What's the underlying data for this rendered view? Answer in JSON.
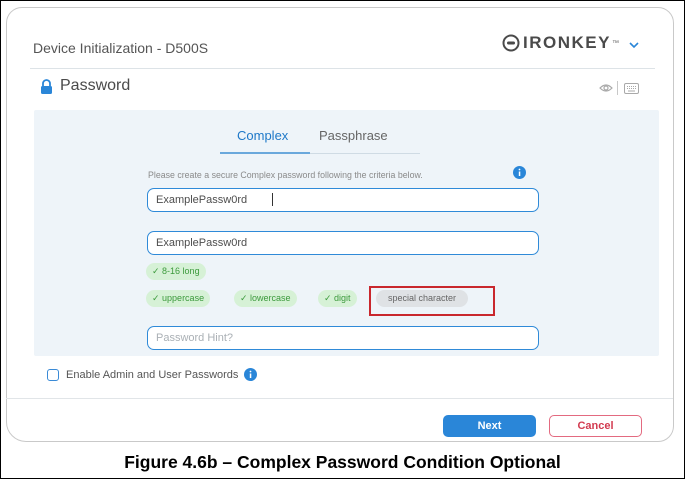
{
  "window": {
    "title": "Device Initialization - D500S",
    "brand": "IRONKEY",
    "brand_tm": "™"
  },
  "section": {
    "label": "Password"
  },
  "tabs": [
    {
      "label": "Complex",
      "active": true
    },
    {
      "label": "Passphrase",
      "active": false
    }
  ],
  "instructions": "Please create a secure Complex password following the criteria below.",
  "fields": {
    "password_value": "ExamplePassw0rd",
    "confirm_value": "ExamplePassw0rd",
    "hint_placeholder": "Password Hint?"
  },
  "criteria": [
    {
      "label": "✓ 8-16 long",
      "met": true
    },
    {
      "label": "✓ uppercase",
      "met": true
    },
    {
      "label": "✓ lowercase",
      "met": true
    },
    {
      "label": "✓ digit",
      "met": true
    },
    {
      "label": "special character",
      "met": false
    }
  ],
  "admin_option": {
    "label": "Enable Admin and User Passwords",
    "checked": false
  },
  "buttons": {
    "next": "Next",
    "cancel": "Cancel"
  },
  "caption": "Figure 4.6b – Complex Password Condition Optional",
  "colors": {
    "accent": "#2a86d8",
    "success_bg": "#d6f1d6",
    "success_text": "#3c9a3c",
    "cancel": "#d23b50",
    "highlight": "#c9272d",
    "panel_bg": "#eef4f9"
  },
  "icons": [
    "ironkey-logo-icon",
    "chevron-down-icon",
    "lock-icon",
    "eye-icon",
    "keyboard-icon",
    "info-icon"
  ]
}
